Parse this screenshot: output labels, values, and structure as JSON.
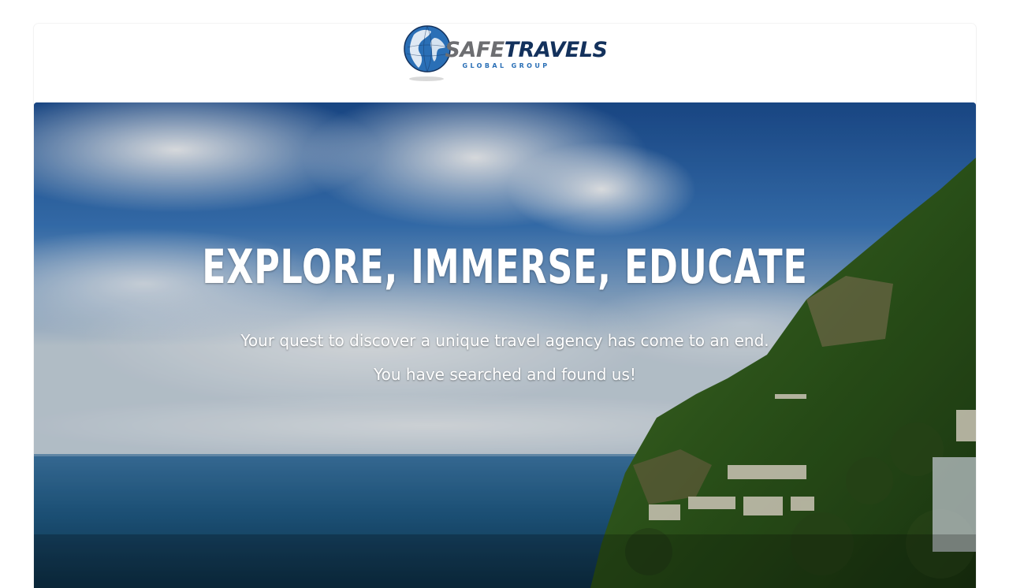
{
  "brand": {
    "name_part1": "SAFE",
    "name_part2": "TRAVELS",
    "tagline": "GLOBAL GROUP",
    "logo_icon": "globe-icon",
    "colors": {
      "safe": "#6d6e71",
      "travels": "#13315c",
      "tagline": "#2a6fb6"
    }
  },
  "hero": {
    "title": "EXPLORE, IMMERSE, EDUCATE",
    "line1": "Your quest to discover a unique travel agency has come to an end.",
    "line2": "You have searched and found us!",
    "background": "coastal-cliff-village-sea-sky-photo"
  }
}
